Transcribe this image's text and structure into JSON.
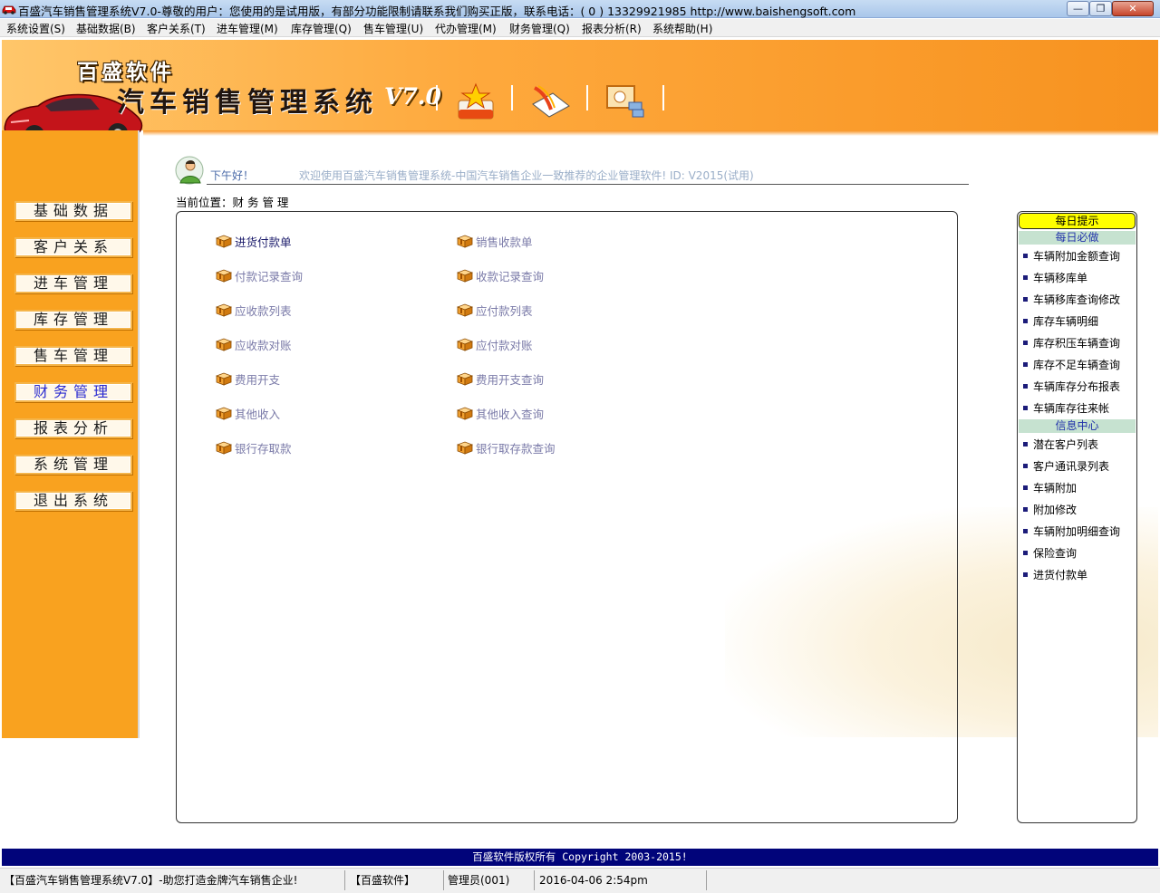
{
  "window": {
    "title": "百盛汽车销售管理系统V7.0-尊敬的用户：您使用的是试用版，有部分功能限制请联系我们购买正版，联系电话：( 0 ) 13329921985  http://www.baishengsoft.com",
    "minimize": "—",
    "maximize": "❐",
    "close": "✕"
  },
  "menu": [
    "系统设置(S)",
    "基础数据(B)",
    "客户关系(T)",
    "进车管理(M)",
    "库存管理(Q)",
    "售车管理(U)",
    "代办管理(M)",
    "财务管理(Q)",
    "报表分析(R)",
    "系统帮助(H)"
  ],
  "header": {
    "brand": "百盛软件",
    "product": "汽车销售管理系统",
    "version": "V7.0",
    "toolbar_icons": [
      "star-note-icon",
      "notebook-pen-icon",
      "presentation-icon"
    ]
  },
  "nav": [
    "基础数据",
    "客户关系",
    "进车管理",
    "库存管理",
    "售车管理",
    "财务管理",
    "报表分析",
    "系统管理",
    "退出系统"
  ],
  "nav_active_index": 5,
  "greeting": {
    "hello": "下午好！",
    "welcome": "欢迎使用百盛汽车销售管理系统-中国汽车销售企业一致推荐的企业管理软件! ID: V2015(试用)"
  },
  "location": "当前位置：财 务 管 理",
  "functions": {
    "col1": [
      "进货付款单",
      "付款记录查询",
      "应收款列表",
      "应收款对账",
      "费用开支",
      "其他收入",
      "银行存取款"
    ],
    "col2": [
      "销售收款单",
      "收款记录查询",
      "应付款列表",
      "应付款对账",
      "费用开支查询",
      "其他收入查询",
      "银行取存款查询"
    ]
  },
  "daily": {
    "title": "每日提示",
    "section1": "每日必做",
    "items1": [
      "车辆附加金额查询",
      "车辆移库单",
      "车辆移库查询修改",
      "库存车辆明细",
      "库存积压车辆查询",
      "库存不足车辆查询",
      "车辆库存分布报表",
      "车辆库存往来帐"
    ],
    "section2": "信息中心",
    "items2": [
      "潜在客户列表",
      "客户通讯录列表",
      "车辆附加",
      "附加修改",
      "车辆附加明细查询",
      "保险查询",
      "进货付款单"
    ]
  },
  "footer": "百盛软件版权所有 Copyright 2003-2015!",
  "status": {
    "app": "【百盛汽车销售管理系统V7.0】-助您打造金牌汽车销售企业!",
    "company": "【百盛软件】",
    "user": "管理员(001)",
    "datetime": "2016-04-06  2:54pm"
  },
  "colors": {
    "header_orange": "#f7921f",
    "sidebar_orange": "#f9a21f",
    "footer_navy": "#01047a",
    "daily_title_yellow": "#ffff00",
    "section_green": "#c6e2d0"
  }
}
